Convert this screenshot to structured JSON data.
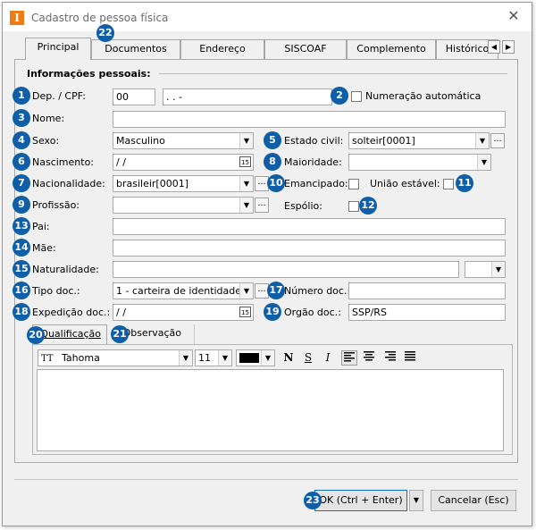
{
  "window": {
    "app_icon_letter": "I",
    "title": "Cadastro de pessoa física",
    "close_glyph": "✕"
  },
  "tabs": {
    "items": [
      {
        "label": "Principal",
        "active": true
      },
      {
        "label": "Documentos"
      },
      {
        "label": "Endereço"
      },
      {
        "label": "SISCOAF"
      },
      {
        "label": "Complemento"
      },
      {
        "label": "Histórico"
      }
    ],
    "scroll_left": "◀",
    "scroll_right": "▶"
  },
  "section": {
    "title": "Informações pessoais:"
  },
  "fields": {
    "dep_cpf_label": "Dep. / CPF:",
    "dep_value": "00",
    "cpf_value": " .  .  -",
    "numeracao_label": "Numeração automática",
    "nome_label": "Nome:",
    "nome_value": "",
    "sexo_label": "Sexo:",
    "sexo_value": "Masculino",
    "estado_civil_label": "Estado civil:",
    "estado_civil_value": "solteir[0001]",
    "nascimento_label": "Nascimento:",
    "nascimento_value": " / /",
    "maioridade_label": "Maioridade:",
    "maioridade_value": "",
    "nacionalidade_label": "Nacionalidade:",
    "nacionalidade_value": "brasileir[0001]",
    "emancipado_label": "Emancipado:",
    "uniao_label": "União estável:",
    "profissao_label": "Profissão:",
    "profissao_value": "",
    "espolio_label": "Espólio:",
    "pai_label": "Pai:",
    "pai_value": "",
    "mae_label": "Mãe:",
    "mae_value": "",
    "naturalidade_label": "Naturalidade:",
    "naturalidade_value": "",
    "uf_value": "",
    "tipo_doc_label": "Tipo doc.:",
    "tipo_doc_value": "1 - carteira de identidade",
    "numero_doc_label": "Número doc.:",
    "numero_doc_value": "",
    "expedicao_label": "Expedição doc.:",
    "expedicao_value": " / /",
    "orgao_label": "Orgão doc.:",
    "orgao_value": "SSP/RS",
    "calendar_glyph": "15",
    "dots_glyph": "..."
  },
  "subtabs": {
    "qualificacao": "Qualificação",
    "observacao": "Observação"
  },
  "editor": {
    "font_name": "Tahoma",
    "font_size": "11",
    "color": "#000000",
    "bold": "N",
    "underline": "S",
    "italic": "I"
  },
  "buttons": {
    "ok_label": "OK (Ctrl + Enter)",
    "cancel_label": "Cancelar (Esc)"
  },
  "badges": [
    "1",
    "2",
    "3",
    "4",
    "5",
    "6",
    "7",
    "8",
    "9",
    "10",
    "11",
    "12",
    "13",
    "14",
    "15",
    "16",
    "17",
    "18",
    "19",
    "20",
    "21",
    "22",
    "23"
  ],
  "colors": {
    "badge": "#0f5fa8",
    "app_icon": "#f07b16",
    "default_button_border": "#0f6fc6"
  }
}
